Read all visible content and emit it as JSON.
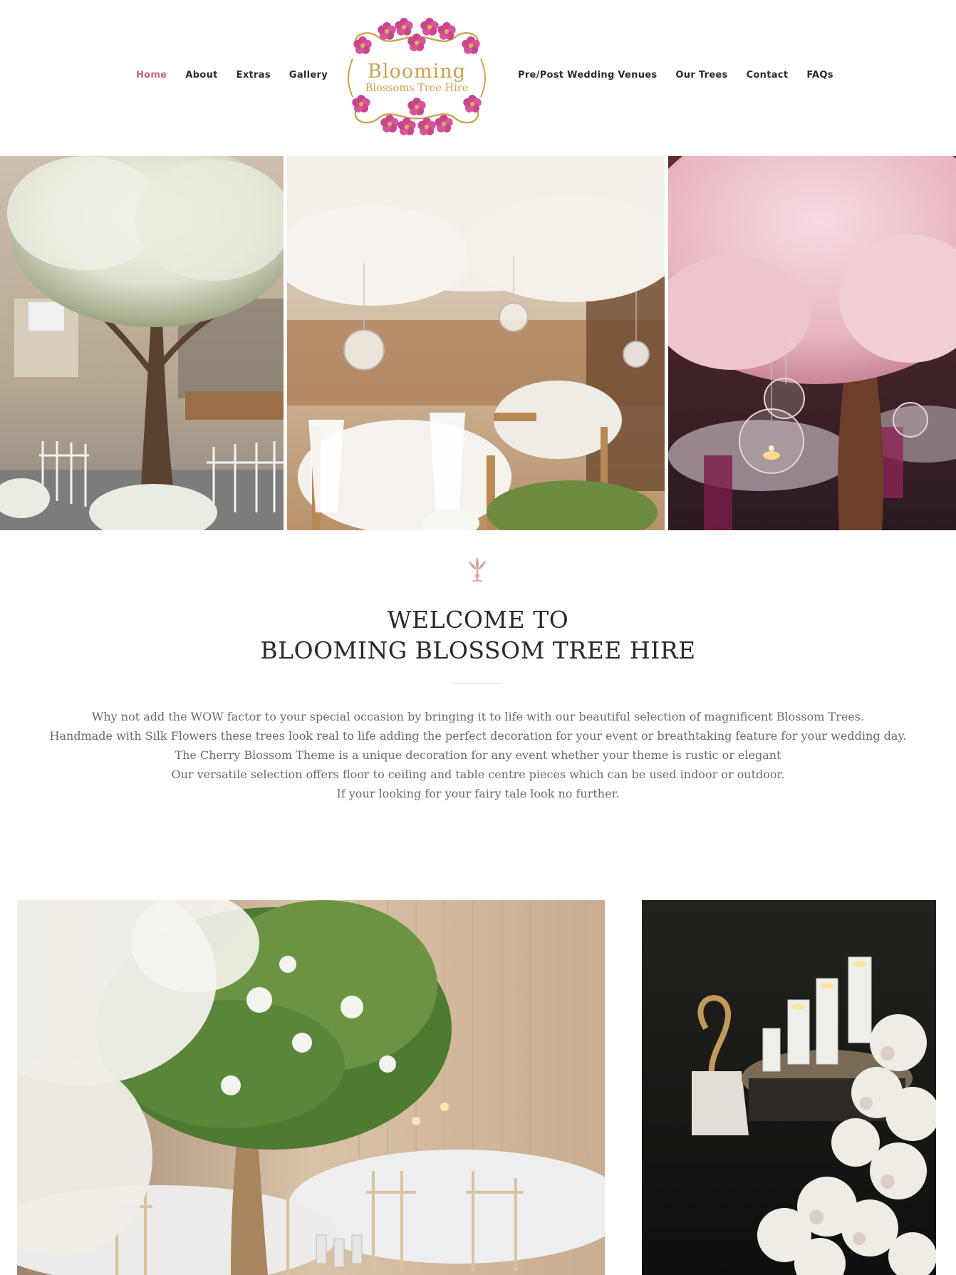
{
  "brand": {
    "logo_line1": "Blooming",
    "logo_line2": "Blossoms Tree Hire",
    "colors": {
      "accent": "#c2648b",
      "gold": "#c9a34e",
      "blossom": "#c9458c"
    }
  },
  "nav": {
    "left": [
      {
        "label": "Home",
        "active": true
      },
      {
        "label": "About"
      },
      {
        "label": "Extras"
      },
      {
        "label": "Gallery"
      }
    ],
    "right": [
      {
        "label": "Pre/Post Wedding Venues"
      },
      {
        "label": "Our Trees"
      },
      {
        "label": "Contact"
      },
      {
        "label": "FAQs"
      }
    ]
  },
  "welcome": {
    "title_line1": "WELCOME TO",
    "title_line2": "BLOOMING BLOSSOM TREE HIRE",
    "paragraphs": [
      "Why not add the WOW factor to your special occasion by bringing it to life with our beautiful selection of magnificent Blossom Trees.",
      "Handmade with Silk Flowers these trees look real to life adding the perfect decoration for your event or breathtaking feature for your wedding day.",
      "The Cherry Blossom Theme is a unique decoration for any event whether your theme is rustic or elegant",
      "Our versatile selection offers floor to ceiling and table centre pieces which can be used indoor or outdoor.",
      "If your looking for your fairy tale look no further."
    ]
  }
}
